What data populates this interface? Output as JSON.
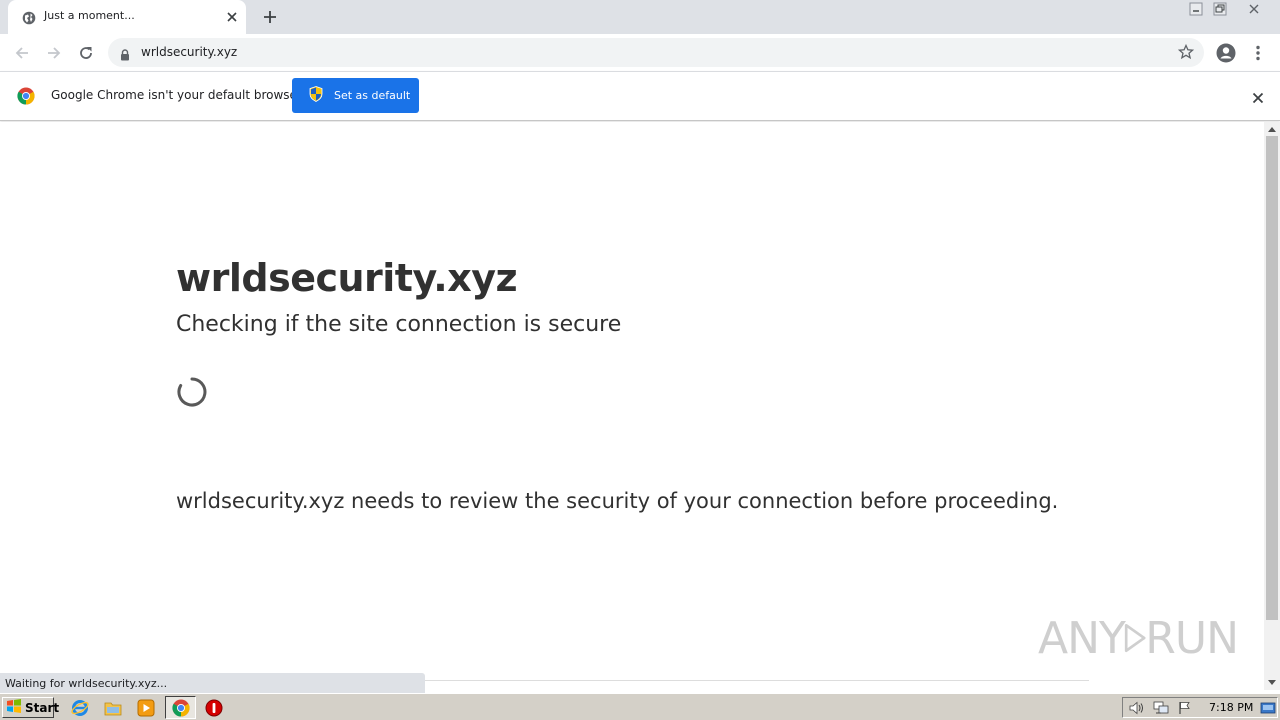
{
  "browser": {
    "tab": {
      "title": "Just a moment..."
    },
    "address_bar": {
      "url": "wrldsecurity.xyz"
    },
    "infobar": {
      "message": "Google Chrome isn't your default browser",
      "button_label": "Set as default"
    },
    "status_bubble": "Waiting for wrldsecurity.xyz..."
  },
  "page": {
    "title": "wrldsecurity.xyz",
    "subtitle": "Checking if the site connection is secure",
    "body": "wrldsecurity.xyz needs to review the security of your connection before proceeding."
  },
  "watermark": {
    "left": "ANY",
    "right": "RUN"
  },
  "taskbar": {
    "start_label": "Start",
    "clock": "7:18 PM"
  },
  "colors": {
    "accent": "#1a73e8",
    "tabstrip": "#dee1e6",
    "taskbar": "#d4d0c8",
    "text": "#313131"
  }
}
